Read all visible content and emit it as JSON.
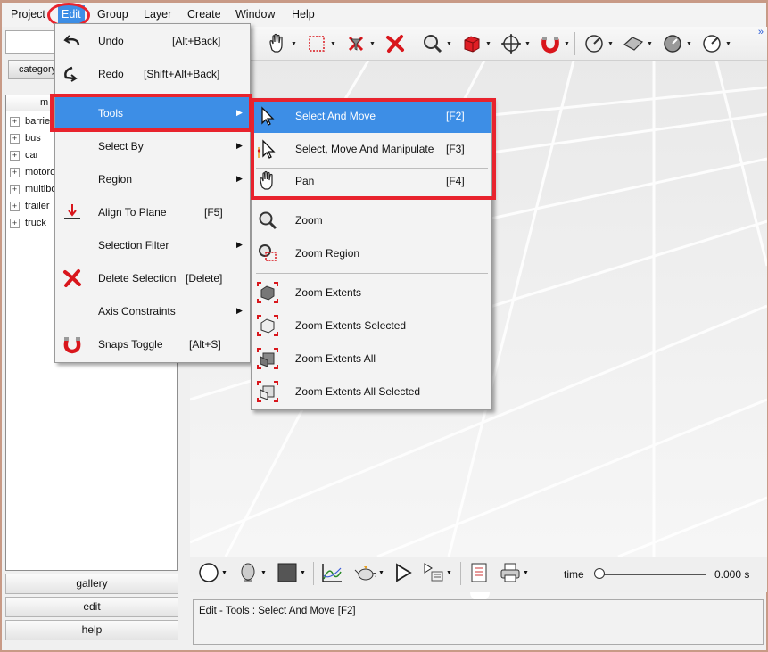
{
  "menubar": {
    "items": [
      "Project",
      "Edit",
      "Group",
      "Layer",
      "Create",
      "Window",
      "Help"
    ],
    "active": "Edit"
  },
  "left_panel": {
    "tab_label": "category",
    "column_header": "m",
    "tree_items": [
      "barrie",
      "bus",
      "car",
      "motoro",
      "multibo",
      "trailer",
      "truck"
    ],
    "buttons": [
      "gallery",
      "edit",
      "help"
    ]
  },
  "toolbar": {
    "more": "»"
  },
  "edit_menu": {
    "items": [
      {
        "label": "Undo",
        "shortcut": "[Alt+Back]",
        "icon": "undo-icon"
      },
      {
        "label": "Redo",
        "shortcut": "[Shift+Alt+Back]",
        "icon": "redo-icon"
      },
      {
        "label": "Tools",
        "submenu": true,
        "highlighted": true
      },
      {
        "label": "Select By",
        "submenu": true
      },
      {
        "label": "Region",
        "submenu": true
      },
      {
        "label": "Align To Plane",
        "shortcut": "[F5]",
        "icon": "align-to-plane-icon"
      },
      {
        "label": "Selection Filter",
        "submenu": true
      },
      {
        "label": "Delete Selection",
        "shortcut": "[Delete]",
        "icon": "delete-icon"
      },
      {
        "label": "Axis Constraints",
        "submenu": true
      },
      {
        "label": "Snaps Toggle",
        "shortcut": "[Alt+S]",
        "icon": "magnet-icon"
      }
    ]
  },
  "tools_menu": {
    "items": [
      {
        "label": "Select And Move",
        "shortcut": "[F2]",
        "icon": "select-arrow-icon",
        "highlighted": true
      },
      {
        "label": "Select, Move And Manipulate",
        "shortcut": "[F3]",
        "icon": "manipulate-arrow-icon"
      },
      {
        "label": "Pan",
        "shortcut": "[F4]",
        "icon": "hand-icon"
      },
      {
        "label": "Zoom",
        "icon": "zoom-icon"
      },
      {
        "label": "Zoom Region",
        "icon": "zoom-region-icon"
      },
      {
        "label": "Zoom Extents",
        "icon": "zoom-extents-icon"
      },
      {
        "label": "Zoom Extents Selected",
        "icon": "zoom-extents-selected-icon"
      },
      {
        "label": "Zoom Extents All",
        "icon": "zoom-extents-all-icon"
      },
      {
        "label": "Zoom Extents All Selected",
        "icon": "zoom-extents-all-selected-icon"
      }
    ]
  },
  "bottom_bar": {
    "time_label": "time",
    "time_value": "0.000 s",
    "slider_position": 0.0
  },
  "status": {
    "text": "Edit - Tools : Select And Move [F2]"
  },
  "colors": {
    "highlight": "#3d8ee6",
    "annotation_red": "#e8232d",
    "icon_red": "#d9161c"
  }
}
